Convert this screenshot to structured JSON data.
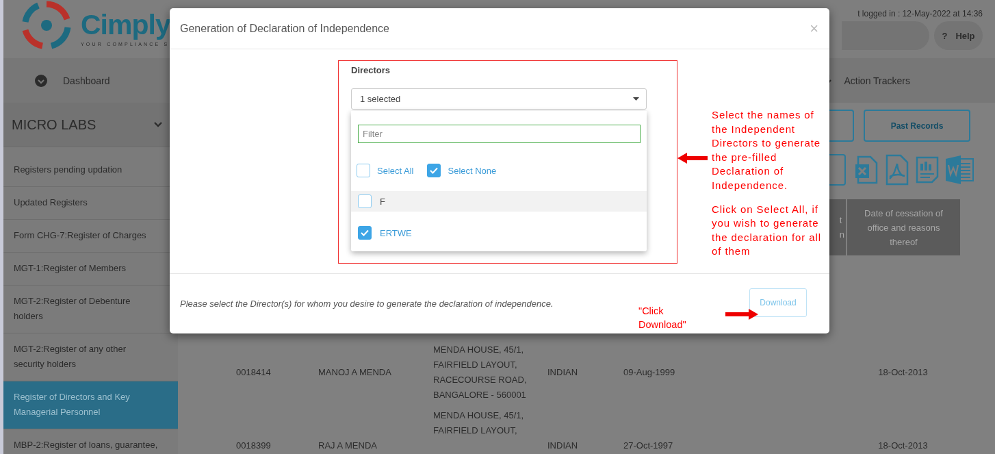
{
  "header": {
    "logo_text": "Cimply",
    "logo_tagline": "YOUR COMPLIANCE S",
    "last_login": "t logged in : 12-May-2022 at 14:36",
    "help_icon": "?",
    "help_label": "Help"
  },
  "nav": [
    {
      "label": "Dashboard",
      "kind": "dashboard"
    },
    {
      "label": "Action Trackers",
      "kind": "tracker"
    }
  ],
  "sidebar": {
    "company": "MICRO LABS",
    "items": [
      {
        "label": "Registers pending updation",
        "selected": false
      },
      {
        "label": "Updated Registers",
        "selected": false
      },
      {
        "label": "Form CHG-7:Register of Charges",
        "selected": false
      },
      {
        "label": "MGT-1:Register of Members",
        "selected": false
      },
      {
        "label": "MGT-2:Register of Debenture holders",
        "selected": false
      },
      {
        "label": "MGT-2:Register of any other security holders",
        "selected": false
      },
      {
        "label": "Register of Directors and Key Managerial Personnel",
        "selected": true
      },
      {
        "label": "MBP-2:Register of loans, guarantee,",
        "selected": false
      }
    ]
  },
  "toolbar": {
    "buttons": [
      "Past Records"
    ]
  },
  "table": {
    "columns": [
      {
        "lines": [
          "t",
          "n"
        ]
      },
      {
        "lines": [
          "Date of cessation of",
          "office and reasons",
          "thereof"
        ]
      }
    ],
    "rows": [
      {
        "column_2": "0018414",
        "column_3": "MANOJ A MENDA",
        "column_4": [
          "MENDA HOUSE, 45/1,",
          "FAIRFIELD LAYOUT,",
          "RACECOURSE ROAD,",
          "BANGALORE - 560001"
        ],
        "column_5": "INDIAN",
        "column_6": "09-Aug-1999",
        "date_of_cessation": "18-Oct-2013"
      },
      {
        "column_2": "0018399",
        "column_3": "RAJ A MENDA",
        "column_4": [
          "MENDA HOUSE, 45/1,",
          "FAIRFIELD LAYOUT,"
        ],
        "column_5": "INDIAN",
        "column_6": "27-Oct-1997",
        "date_of_cessation": "18-Oct-2013"
      }
    ]
  },
  "modal": {
    "title": "Generation of Declaration of Independence",
    "close": "×",
    "field_label": "Directors",
    "dropdown_value": "1 selected",
    "filter_placeholder": "Filter",
    "bulk_options": [
      {
        "label": "Select All",
        "checked": false
      },
      {
        "label": "Select None",
        "checked": true
      }
    ],
    "options": [
      {
        "label": "F",
        "checked": false,
        "highlighted": true
      },
      {
        "label": "ERTWE",
        "checked": true,
        "highlighted": false
      }
    ],
    "footer_note": "Please select the Director(s) for whom you desire to generate the declaration of independence.",
    "download_button": "Download"
  },
  "annotations": {
    "callout": [
      "Select the names of the Independent Directors to generate the pre-filled Declaration of Independence.",
      "Click on Select All, if you wish to generate the declaration for all of them"
    ],
    "download_hint": "\"Click Download\""
  }
}
